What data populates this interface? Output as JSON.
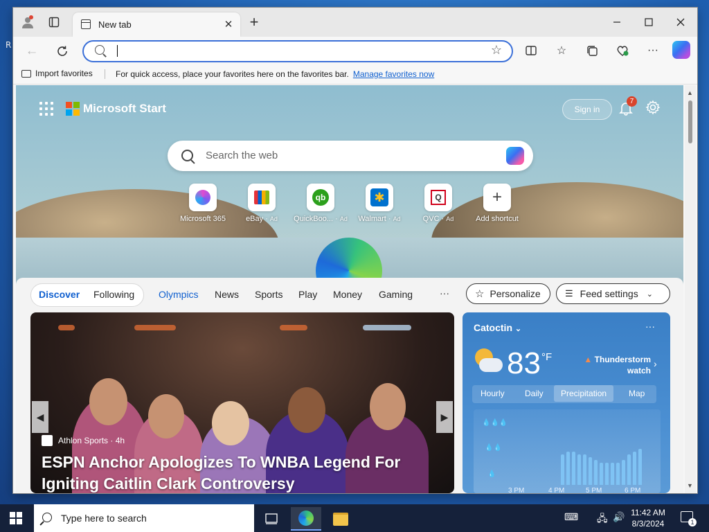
{
  "desktop": {
    "label": "R"
  },
  "browser": {
    "tab_title": "New tab",
    "address_value": "",
    "favbar": {
      "import_label": "Import favorites",
      "message": "For quick access, place your favorites here on the favorites bar.",
      "link": "Manage favorites now"
    }
  },
  "start": {
    "brand": "Microsoft Start",
    "sign_in": "Sign in",
    "notification_count": "7",
    "search_placeholder": "Search the web",
    "shortcuts": [
      {
        "label": "Microsoft 365",
        "ad": ""
      },
      {
        "label": "eBay",
        "ad": "Ad"
      },
      {
        "label": "QuickBoo...",
        "ad": "Ad"
      },
      {
        "label": "Walmart",
        "ad": "Ad"
      },
      {
        "label": "QVC",
        "ad": "Ad"
      },
      {
        "label": "Add shortcut",
        "ad": ""
      }
    ]
  },
  "feed": {
    "tabs": {
      "discover": "Discover",
      "following": "Following",
      "olympics": "Olympics",
      "news": "News",
      "sports": "Sports",
      "play": "Play",
      "money": "Money",
      "gaming": "Gaming",
      "more": "···"
    },
    "personalize": "Personalize",
    "feed_settings": "Feed settings",
    "hero": {
      "source": "Athlon Sports · 4h",
      "headline": "ESPN Anchor Apologizes To WNBA Legend For Igniting Caitlin Clark Controversy"
    }
  },
  "weather": {
    "location": "Catoctin",
    "temperature": "83",
    "unit": "°F",
    "alert": "Thunderstorm watch",
    "tabs": {
      "hourly": "Hourly",
      "daily": "Daily",
      "precipitation": "Precipitation",
      "map": "Map"
    },
    "times": [
      "3 PM",
      "4 PM",
      "5 PM",
      "6 PM"
    ],
    "precip_levels": [
      0.55,
      0.6,
      0.6,
      0.55,
      0.55,
      0.5,
      0.45,
      0.4,
      0.4,
      0.4,
      0.4,
      0.45,
      0.55,
      0.6,
      0.65
    ],
    "colors": {
      "bar": "#7fc3f4"
    }
  },
  "taskbar": {
    "search_placeholder": "Type here to search",
    "time": "11:42 AM",
    "date": "8/3/2024",
    "notification_count": "1"
  }
}
